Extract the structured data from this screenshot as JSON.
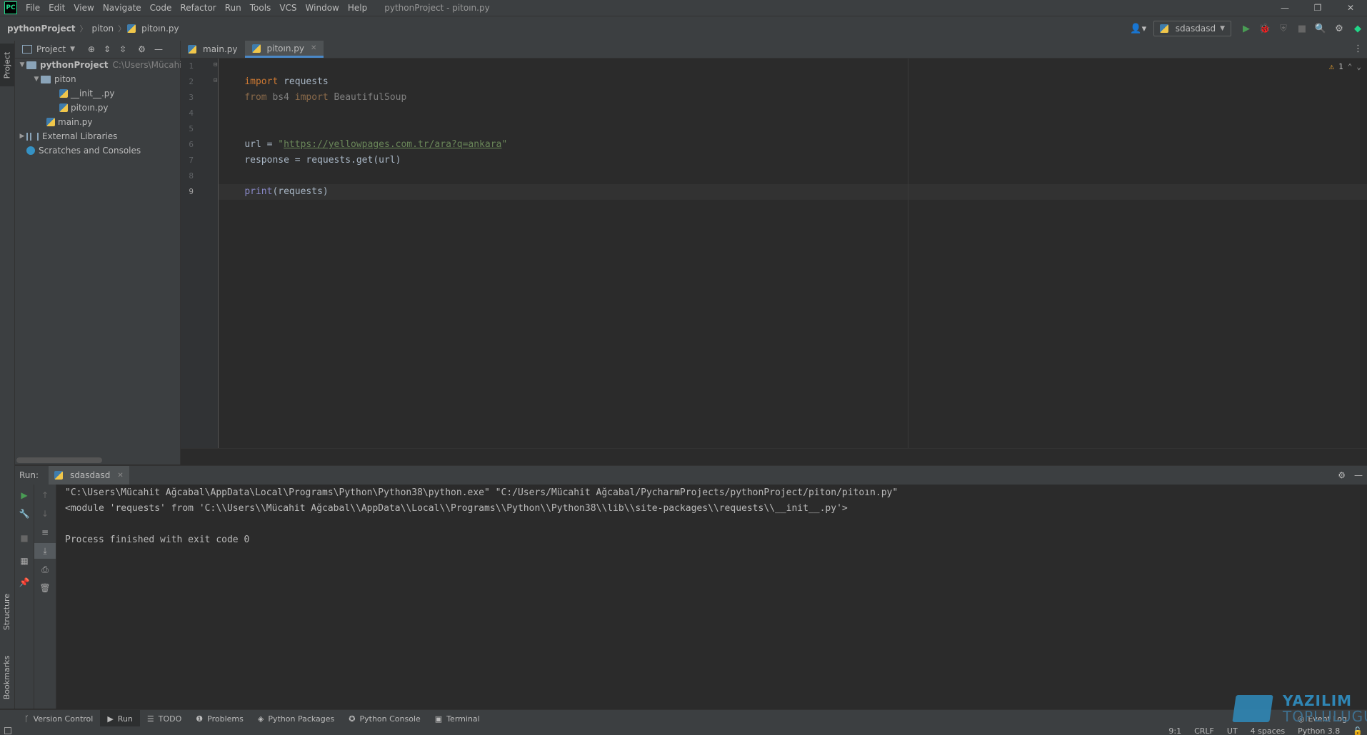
{
  "menubar": {
    "logo": "PC",
    "items": [
      "File",
      "Edit",
      "View",
      "Navigate",
      "Code",
      "Refactor",
      "Run",
      "Tools",
      "VCS",
      "Window",
      "Help"
    ],
    "window_title": "pythonProject - pitoın.py",
    "controls": {
      "minimize": "—",
      "restore": "❐",
      "close": "✕"
    }
  },
  "navbar": {
    "breadcrumbs": [
      "pythonProject",
      "piton",
      "pitoın.py"
    ],
    "run_config": "sdasdasd"
  },
  "left_stripe": {
    "project": "Project",
    "structure": "Structure",
    "bookmarks": "Bookmarks"
  },
  "project_panel": {
    "title": "Project",
    "tree": [
      {
        "label": "pythonProject",
        "hint": "C:\\Users\\Mücahit A"
      },
      {
        "label": "piton"
      },
      {
        "label": "__init__.py"
      },
      {
        "label": "pitoın.py"
      },
      {
        "label": "main.py"
      },
      {
        "label": "External Libraries"
      },
      {
        "label": "Scratches and Consoles"
      }
    ]
  },
  "editor": {
    "tabs": [
      {
        "label": "main.py"
      },
      {
        "label": "pitoın.py"
      }
    ],
    "line_numbers": [
      "1",
      "2",
      "3",
      "4",
      "5",
      "6",
      "7",
      "8",
      "9"
    ],
    "code": {
      "l1_kw": "import",
      "l1_rest": " requests",
      "l2_kw": "from",
      "l2_rest": " bs4 ",
      "l2_kw2": "import",
      "l2_rest2": " BeautifulSoup",
      "l5_a": "url = ",
      "l5_q1": "\"",
      "l5_url": "https://yellowpages.com.tr/ara?q=ankara",
      "l5_q2": "\"",
      "l6": "response = requests.get(url)",
      "l8_fn": "print",
      "l8_rest": "(requests)"
    },
    "warnings_count": "1"
  },
  "run_window": {
    "label": "Run:",
    "tab": "sdasdasd",
    "output": [
      "\"C:\\Users\\Mücahit Ağcabal\\AppData\\Local\\Programs\\Python\\Python38\\python.exe\" \"C:/Users/Mücahit Ağcabal/PycharmProjects/pythonProject/piton/pitoın.py\"",
      "<module 'requests' from 'C:\\\\Users\\\\Mücahit Ağcabal\\\\AppData\\\\Local\\\\Programs\\\\Python\\\\Python38\\\\lib\\\\site-packages\\\\requests\\\\__init__.py'>",
      "",
      "Process finished with exit code 0"
    ]
  },
  "bottom_tabs": [
    "Version Control",
    "Run",
    "TODO",
    "Problems",
    "Python Packages",
    "Python Console",
    "Terminal"
  ],
  "event_log": "Event Log",
  "statusbar": {
    "position": "9:1",
    "line_sep": "CRLF",
    "encoding": "UT",
    "indent": "4 spaces",
    "interpreter": "Python 3.8"
  },
  "watermark": {
    "line1": "YAZILIM",
    "line2": "TOPLULUGU"
  },
  "colors": {
    "keyword": "#cc7832",
    "string": "#6a8759",
    "builtin": "#8888c6",
    "accent": "#4a88c7",
    "run_green": "#499c54"
  }
}
